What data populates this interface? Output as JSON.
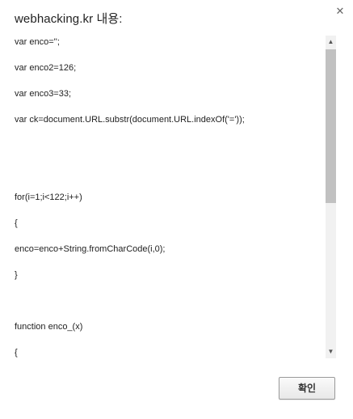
{
  "dialog": {
    "title": "webhacking.kr 내용:",
    "close_icon": "close-icon",
    "close_glyph": "✕",
    "ok_label": "확인"
  },
  "message": {
    "lines": [
      "var enco='';",
      "var enco2=126;",
      "var enco3=33;",
      "var ck=document.URL.substr(document.URL.indexOf('='));",
      "",
      "",
      "for(i=1;i<122;i++)",
      "{",
      "enco=enco+String.fromCharCode(i,0);",
      "}",
      "",
      "function enco_(x)",
      "{"
    ]
  },
  "scrollbar": {
    "up_glyph": "▲",
    "down_glyph": "▼",
    "scroll_position": 0.0
  }
}
